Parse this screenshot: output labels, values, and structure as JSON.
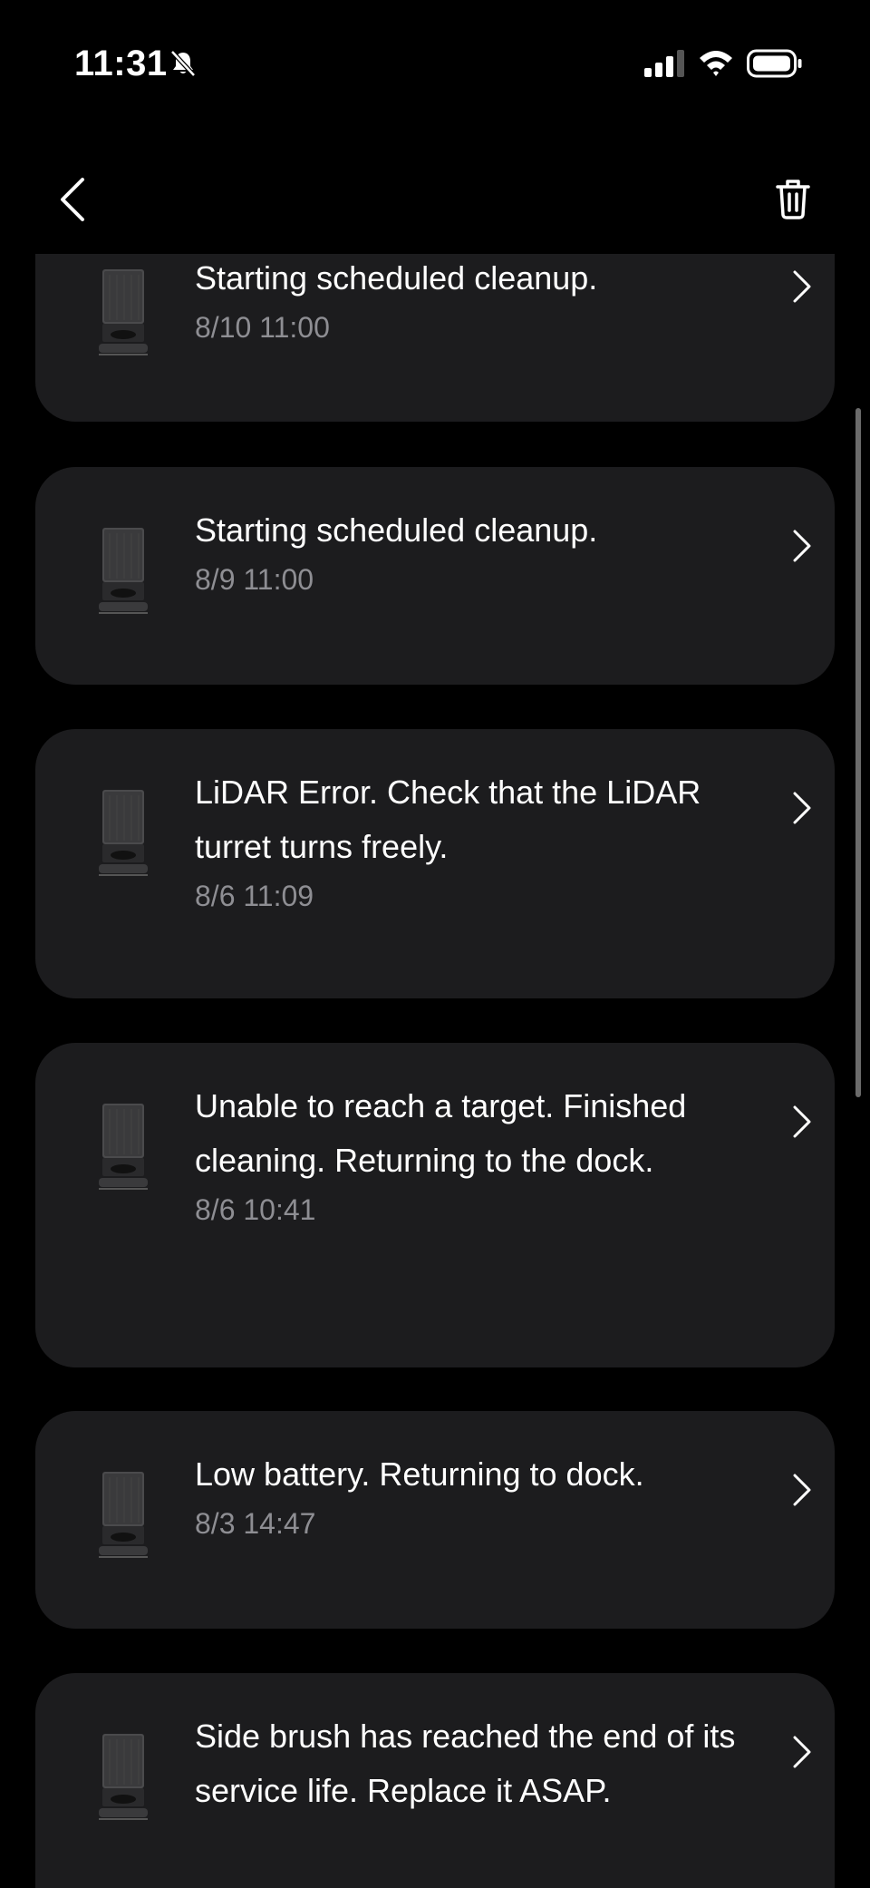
{
  "status_bar": {
    "time": "11:31"
  },
  "notifications": [
    {
      "title": "Starting scheduled cleanup.",
      "time": "8/10 11:00"
    },
    {
      "title": "Starting scheduled cleanup.",
      "time": "8/9 11:00"
    },
    {
      "title": "LiDAR Error. Check that the LiDAR turret turns freely.",
      "time": "8/6 11:09"
    },
    {
      "title": "Unable to reach a target. Finished cleaning. Returning to the dock.",
      "time": "8/6 10:41"
    },
    {
      "title": "Low battery. Returning to dock.",
      "time": "8/3 14:47"
    },
    {
      "title": "Side brush has reached the end of its service life. Replace it ASAP.",
      "time": ""
    }
  ],
  "colors": {
    "background": "#000000",
    "card": "#1c1c1e",
    "secondary_text": "#8e8e93"
  },
  "icons": {
    "back": "chevron-left-icon",
    "delete": "trash-icon",
    "item": "robot-vacuum-dock-icon",
    "row_arrow": "chevron-right-icon"
  }
}
